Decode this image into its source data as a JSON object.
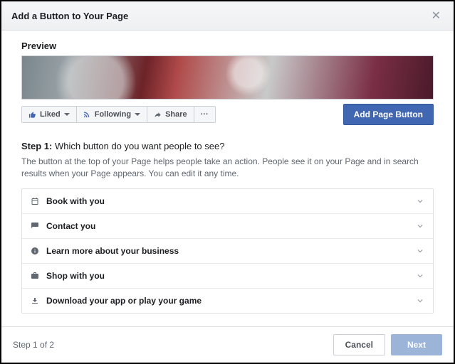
{
  "header": {
    "title": "Add a Button to Your Page"
  },
  "preview": {
    "label": "Preview",
    "liked": "Liked",
    "following": "Following",
    "share": "Share",
    "add_button": "Add Page Button"
  },
  "step": {
    "label": "Step 1:",
    "question": "Which button do you want people to see?",
    "description": "The button at the top of your Page helps people take an action. People see it on your Page and in search results when your Page appears. You can edit it any time."
  },
  "options": {
    "book": "Book with you",
    "contact": "Contact you",
    "learn": "Learn more about your business",
    "shop": "Shop with you",
    "download": "Download your app or play your game"
  },
  "footer": {
    "step_indicator": "Step 1 of 2",
    "cancel": "Cancel",
    "next": "Next"
  }
}
